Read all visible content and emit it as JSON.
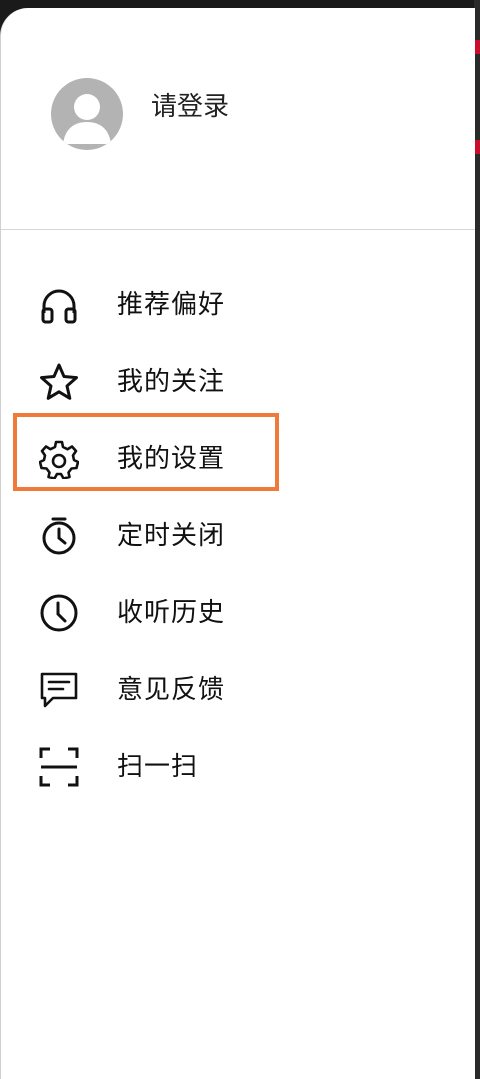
{
  "profile": {
    "login_prompt": "请登录",
    "avatar_icon": "default-user-avatar-icon"
  },
  "menu": {
    "items": [
      {
        "id": "preferences",
        "label": "推荐偏好",
        "icon": "headphones-icon"
      },
      {
        "id": "following",
        "label": "我的关注",
        "icon": "star-icon"
      },
      {
        "id": "settings",
        "label": "我的设置",
        "icon": "gear-icon",
        "highlighted": true
      },
      {
        "id": "sleep-timer",
        "label": "定时关闭",
        "icon": "stopwatch-icon"
      },
      {
        "id": "history",
        "label": "收听历史",
        "icon": "clock-icon"
      },
      {
        "id": "feedback",
        "label": "意见反馈",
        "icon": "chat-bubble-icon"
      },
      {
        "id": "scan",
        "label": "扫一扫",
        "icon": "scan-icon"
      }
    ]
  },
  "colors": {
    "highlight": "#f07a3a",
    "avatar_bg": "#b3b3b3",
    "underlying_accent": "#c8102e"
  }
}
